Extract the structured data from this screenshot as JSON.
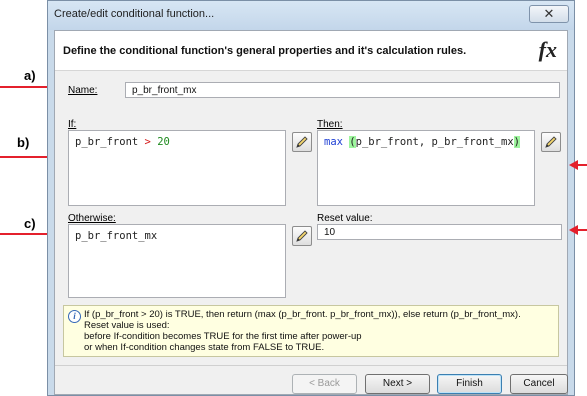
{
  "annotations": {
    "a": "a)",
    "b": "b)",
    "c": "c)"
  },
  "dialog": {
    "title": "Create/edit conditional function...",
    "close_glyph": "✕",
    "header_text": "Define the conditional function's general properties and it's calculation rules.",
    "fx_glyph": "fx"
  },
  "form": {
    "name_label": "Name:",
    "name_value": "p_br_front_mx",
    "if_label": "If:",
    "if_expression": {
      "operand": "p_br_front",
      "operator": ">",
      "value": "20"
    },
    "then_label": "Then:",
    "then_expression": {
      "function": "max",
      "open_paren": "(",
      "args": "p_br_front, p_br_front_mx",
      "close_paren": ")"
    },
    "otherwise_label": "Otherwise:",
    "otherwise_value": "p_br_front_mx",
    "reset_label": "Reset value:",
    "reset_value": "10"
  },
  "info": {
    "line1": "If (p_br_front > 20) is TRUE, then return (max (p_br_front. p_br_front_mx)), else return (p_br_front_mx).",
    "line2": "Reset value is used:",
    "line3": "before If-condition becomes TRUE for the first time after power-up",
    "line4": "or when If-condition changes state from FALSE to TRUE."
  },
  "buttons": {
    "back": "< Back",
    "next": "Next >",
    "finish": "Finish",
    "cancel": "Cancel"
  },
  "colors": {
    "arrow": "#e4202c",
    "keyword": "#1e3fd4",
    "operator": "#d61b1b",
    "number": "#1e8a1e",
    "paren_highlight": "#9ef59e",
    "info_background": "#ffffe1"
  }
}
